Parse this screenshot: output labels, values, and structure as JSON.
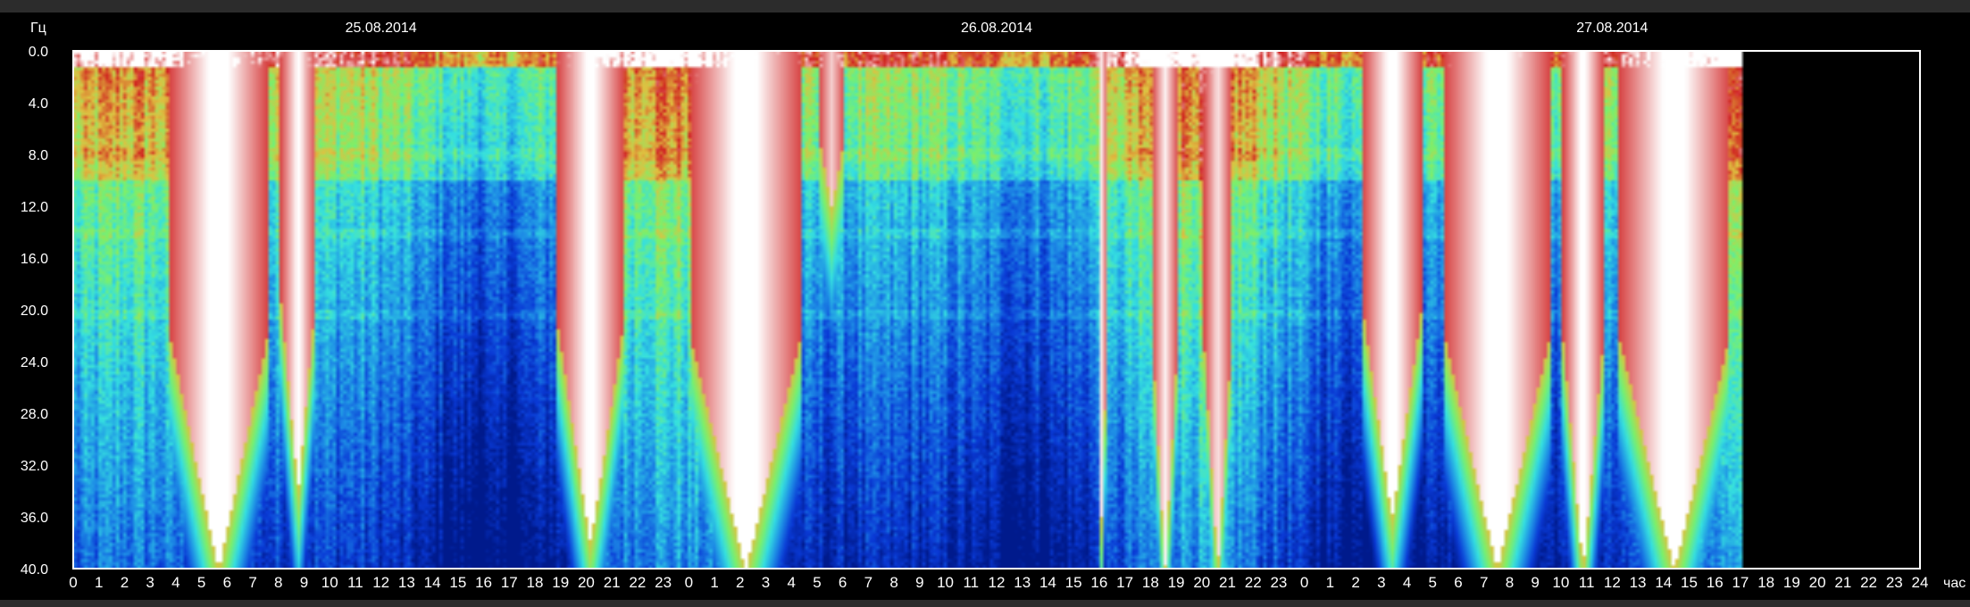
{
  "chart_data": {
    "type": "heatmap",
    "subtype": "spectrogram",
    "title": "",
    "ylabel": "Гц",
    "xlabel": "час",
    "ylim": [
      0,
      40
    ],
    "y_inverted": true,
    "yticks": [
      "0.0",
      "4.0",
      "8.0",
      "12.0",
      "16.0",
      "20.0",
      "24.0",
      "28.0",
      "32.0",
      "36.0",
      "40.0"
    ],
    "xlim_hours": [
      0,
      72
    ],
    "data_end_hour": 65,
    "xticks": [
      "0",
      "1",
      "2",
      "3",
      "4",
      "5",
      "6",
      "7",
      "8",
      "9",
      "10",
      "11",
      "12",
      "13",
      "14",
      "15",
      "16",
      "17",
      "18",
      "19",
      "20",
      "21",
      "22",
      "23",
      "0",
      "1",
      "2",
      "3",
      "4",
      "5",
      "6",
      "7",
      "8",
      "9",
      "10",
      "11",
      "12",
      "13",
      "14",
      "15",
      "16",
      "17",
      "18",
      "19",
      "20",
      "21",
      "22",
      "23",
      "0",
      "1",
      "2",
      "3",
      "4",
      "5",
      "6",
      "7",
      "8",
      "9",
      "10",
      "11",
      "12",
      "13",
      "14",
      "15",
      "16",
      "17",
      "18",
      "19",
      "20",
      "21",
      "22",
      "23",
      "24"
    ],
    "dates": [
      {
        "label": "25.08.2014",
        "hour": 12
      },
      {
        "label": "26.08.2014",
        "hour": 36
      },
      {
        "label": "27.08.2014",
        "hour": 60
      }
    ],
    "colorscale": [
      "#001a8c",
      "#0a3ad6",
      "#1e8ee6",
      "#35e0e0",
      "#7cf06a",
      "#e0c040",
      "#d02020",
      "#ffffff"
    ],
    "grid": false,
    "legend": "none",
    "bright_bands": [
      {
        "start": 3.7,
        "end": 7.5,
        "depth_hz": 40,
        "intensity": 1.0
      },
      {
        "start": 8.0,
        "end": 9.4,
        "depth_hz": 34,
        "intensity": 0.85
      },
      {
        "start": 18.8,
        "end": 21.4,
        "depth_hz": 38,
        "intensity": 0.9
      },
      {
        "start": 24.0,
        "end": 28.3,
        "depth_hz": 40,
        "intensity": 1.0
      },
      {
        "start": 29.0,
        "end": 30.0,
        "depth_hz": 12,
        "intensity": 0.6
      },
      {
        "start": 39.9,
        "end": 40.2,
        "depth_hz": 40,
        "intensity": 0.9
      },
      {
        "start": 42.0,
        "end": 43.0,
        "depth_hz": 40,
        "intensity": 0.75
      },
      {
        "start": 44.0,
        "end": 45.1,
        "depth_hz": 40,
        "intensity": 0.7
      },
      {
        "start": 50.2,
        "end": 52.5,
        "depth_hz": 36,
        "intensity": 0.95
      },
      {
        "start": 53.4,
        "end": 57.5,
        "depth_hz": 40,
        "intensity": 1.0
      },
      {
        "start": 58.0,
        "end": 59.6,
        "depth_hz": 40,
        "intensity": 0.9
      },
      {
        "start": 60.2,
        "end": 64.5,
        "depth_hz": 40,
        "intensity": 1.0
      }
    ]
  }
}
